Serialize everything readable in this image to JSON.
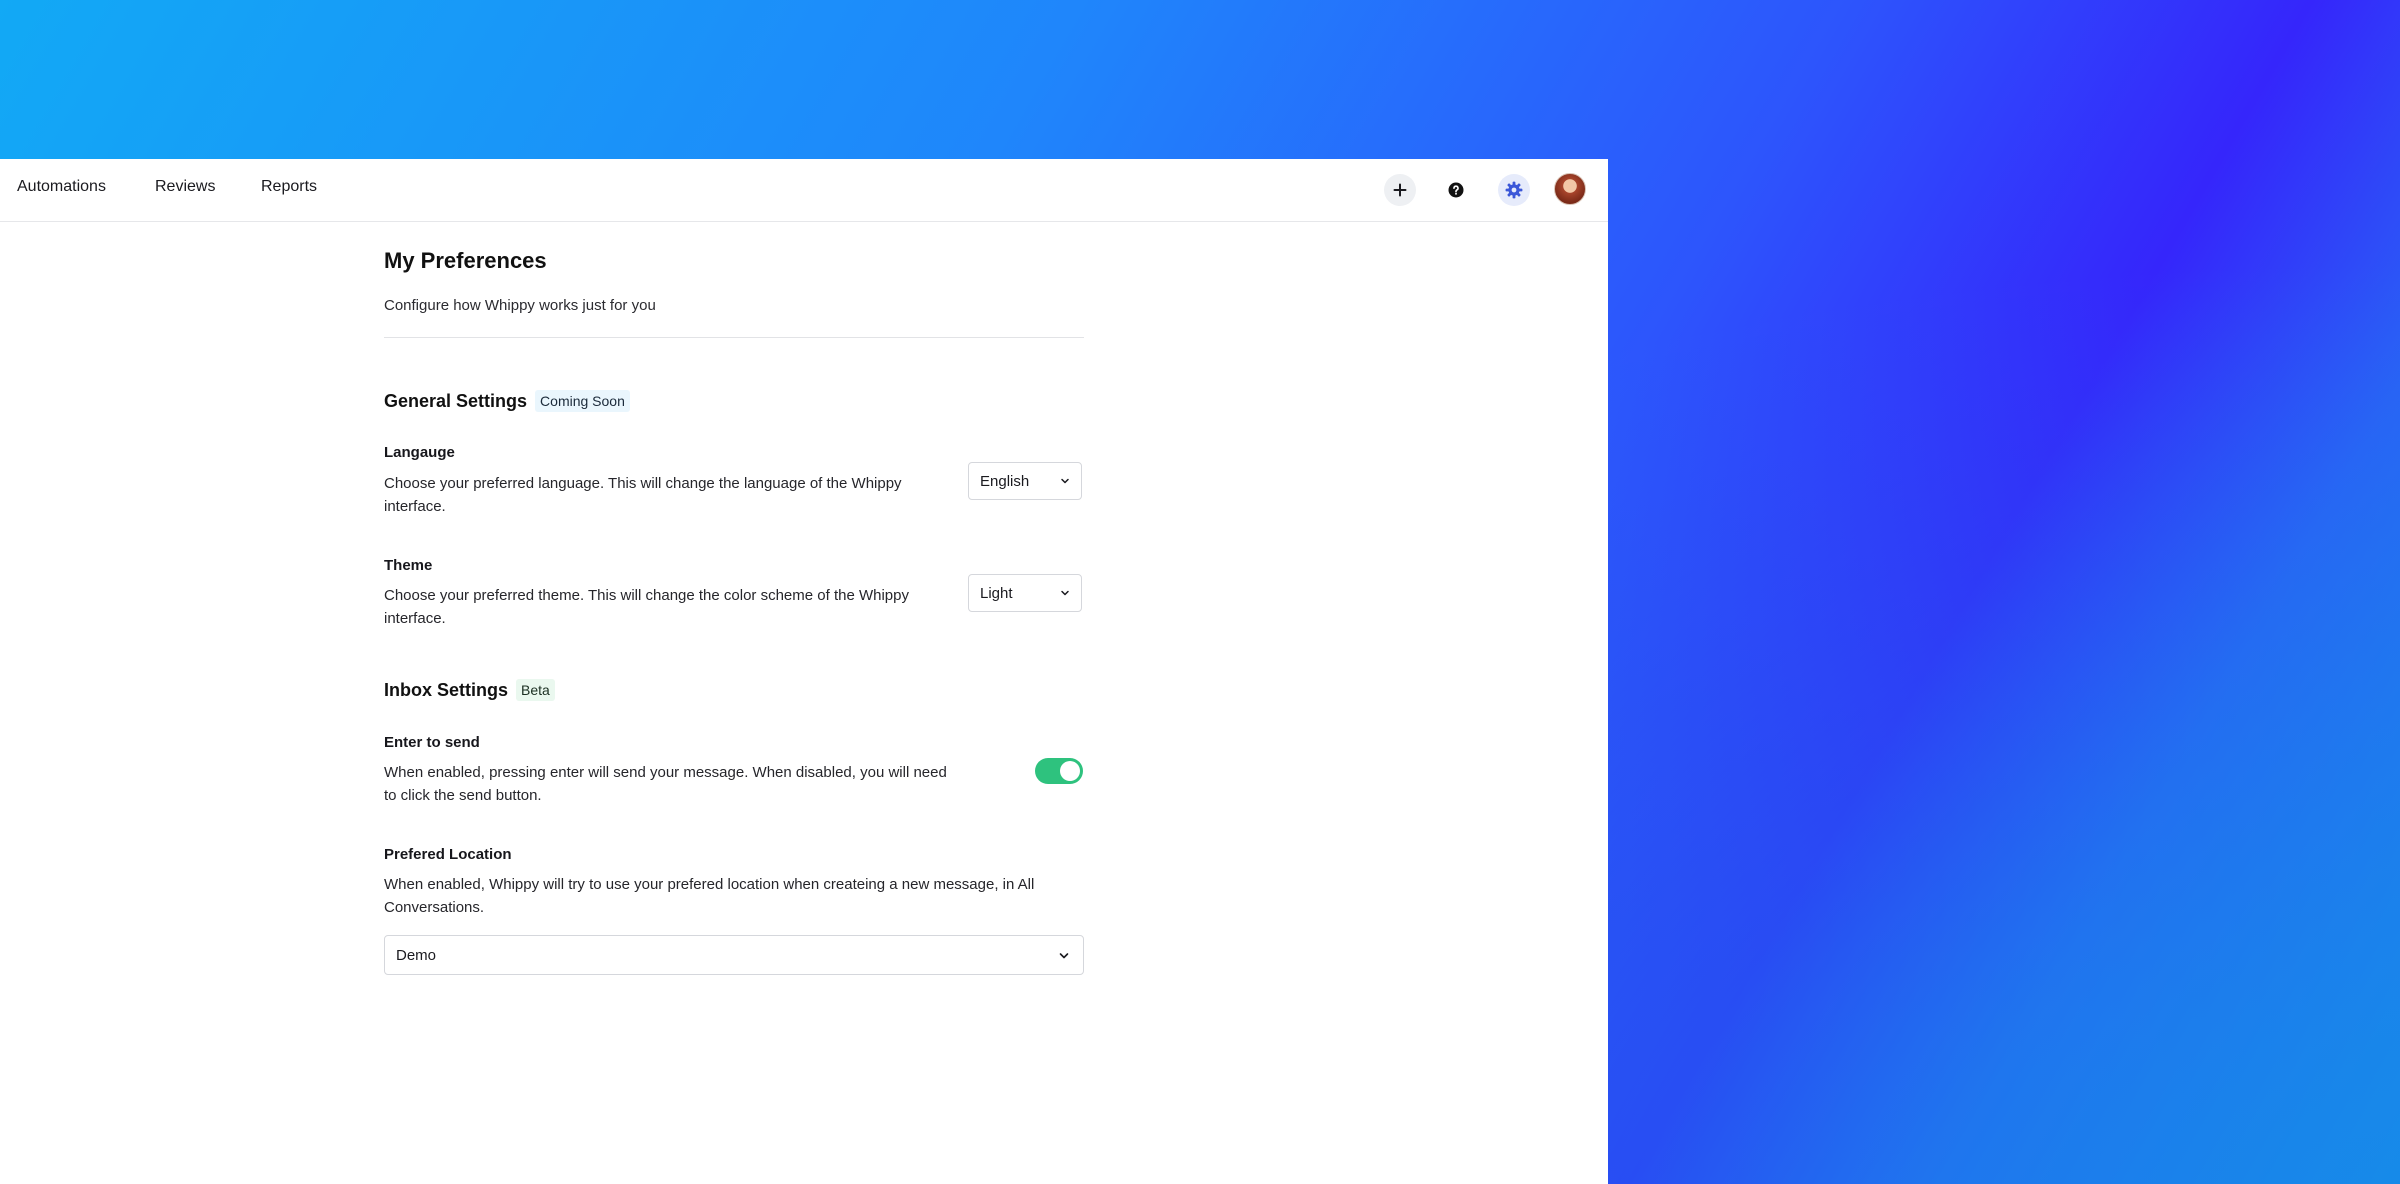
{
  "nav": {
    "items": [
      {
        "label": "Automations"
      },
      {
        "label": "Reviews"
      },
      {
        "label": "Reports"
      }
    ]
  },
  "toolbar": {
    "icons": [
      "plus-icon",
      "help-icon",
      "gear-icon",
      "avatar"
    ]
  },
  "page": {
    "title": "My Preferences",
    "subtitle": "Configure how Whippy works just for you"
  },
  "general": {
    "title": "General Settings",
    "badge": "Coming Soon",
    "language": {
      "label": "Langauge",
      "description": "Choose your preferred language. This will change the language of the Whippy interface.",
      "value": "English"
    },
    "theme": {
      "label": "Theme",
      "description": "Choose your preferred theme. This will change the color scheme of the Whippy interface.",
      "value": "Light"
    }
  },
  "inbox": {
    "title": "Inbox Settings",
    "badge": "Beta",
    "enter_to_send": {
      "label": "Enter to send",
      "description": "When enabled, pressing enter will send your message. When disabled, you will need to click the send button.",
      "enabled": true
    },
    "location": {
      "label": "Prefered Location",
      "description": "When enabled, Whippy will try to use your prefered location when createing a new message, in All Conversations.",
      "value": "Demo"
    }
  },
  "colors": {
    "toggle_on": "#2ec27e",
    "accent": "#3b57d8",
    "background_gradient_start": "#12a9f5",
    "background_gradient_end": "#3526fb"
  }
}
